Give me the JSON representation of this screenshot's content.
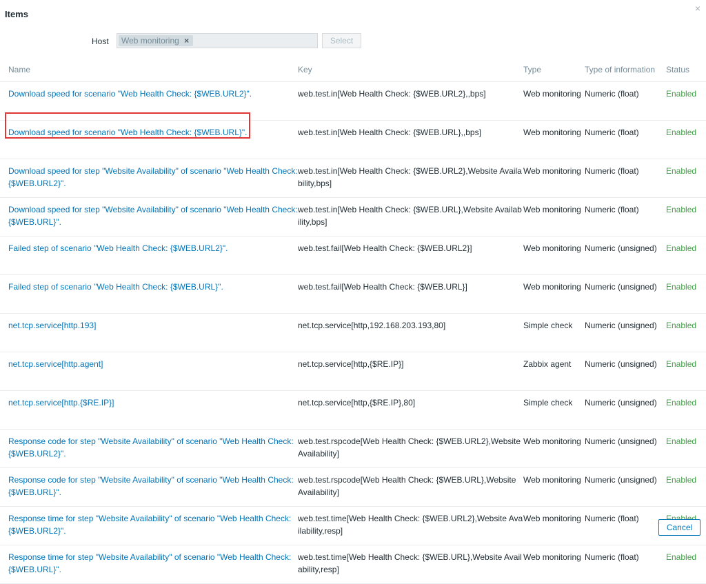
{
  "dialog": {
    "title": "Items",
    "close_icon": "×"
  },
  "filter": {
    "host_label": "Host",
    "selected_host": "Web monitoring",
    "chip_remove": "×",
    "select_button": "Select"
  },
  "table": {
    "columns": [
      "Name",
      "Key",
      "Type",
      "Type of information",
      "Status"
    ],
    "rows": [
      {
        "name": "Download speed for scenario \"Web Health Check: {$WEB.URL2}\".",
        "key": "web.test.in[Web Health Check: {$WEB.URL2},,bps]",
        "type": "Web monitoring",
        "info": "Numeric (float)",
        "status": "Enabled"
      },
      {
        "name": "Download speed for scenario \"Web Health Check: {$WEB.URL}\".",
        "key": "web.test.in[Web Health Check: {$WEB.URL},,bps]",
        "type": "Web monitoring",
        "info": "Numeric (float)",
        "status": "Enabled"
      },
      {
        "name": "Download speed for step \"Website Availability\" of scenario \"Web Health Check: {$WEB.URL2}\".",
        "key": "web.test.in[Web Health Check: {$WEB.URL2},Website Availability,bps]",
        "type": "Web monitoring",
        "info": "Numeric (float)",
        "status": "Enabled"
      },
      {
        "name": "Download speed for step \"Website Availability\" of scenario \"Web Health Check: {$WEB.URL}\".",
        "key": "web.test.in[Web Health Check: {$WEB.URL},Website Availability,bps]",
        "type": "Web monitoring",
        "info": "Numeric (float)",
        "status": "Enabled"
      },
      {
        "name": "Failed step of scenario \"Web Health Check: {$WEB.URL2}\".",
        "key": "web.test.fail[Web Health Check: {$WEB.URL2}]",
        "type": "Web monitoring",
        "info": "Numeric (unsigned)",
        "status": "Enabled"
      },
      {
        "name": "Failed step of scenario \"Web Health Check: {$WEB.URL}\".",
        "key": "web.test.fail[Web Health Check: {$WEB.URL}]",
        "type": "Web monitoring",
        "info": "Numeric (unsigned)",
        "status": "Enabled"
      },
      {
        "name": "net.tcp.service[http.193]",
        "key": "net.tcp.service[http,192.168.203.193,80]",
        "type": "Simple check",
        "info": "Numeric (unsigned)",
        "status": "Enabled"
      },
      {
        "name": "net.tcp.service[http.agent]",
        "key": "net.tcp.service[http,{$RE.IP}]",
        "type": "Zabbix agent",
        "info": "Numeric (unsigned)",
        "status": "Enabled"
      },
      {
        "name": "net.tcp.service[http.{$RE.IP}]",
        "key": "net.tcp.service[http,{$RE.IP},80]",
        "type": "Simple check",
        "info": "Numeric (unsigned)",
        "status": "Enabled"
      },
      {
        "name": "Response code for step \"Website Availability\" of scenario \"Web Health Check: {$WEB.URL2}\".",
        "key": "web.test.rspcode[Web Health Check: {$WEB.URL2},Website Availability]",
        "type": "Web monitoring",
        "info": "Numeric (unsigned)",
        "status": "Enabled"
      },
      {
        "name": "Response code for step \"Website Availability\" of scenario \"Web Health Check: {$WEB.URL}\".",
        "key": "web.test.rspcode[Web Health Check: {$WEB.URL},Website Availability]",
        "type": "Web monitoring",
        "info": "Numeric (unsigned)",
        "status": "Enabled"
      },
      {
        "name": "Response time for step \"Website Availability\" of scenario \"Web Health Check: {$WEB.URL2}\".",
        "key": "web.test.time[Web Health Check: {$WEB.URL2},Website Availability,resp]",
        "type": "Web monitoring",
        "info": "Numeric (float)",
        "status": "Enabled"
      },
      {
        "name": "Response time for step \"Website Availability\" of scenario \"Web Health Check: {$WEB.URL}\".",
        "key": "web.test.time[Web Health Check: {$WEB.URL},Website Availability,resp]",
        "type": "Web monitoring",
        "info": "Numeric (float)",
        "status": "Enabled"
      }
    ]
  },
  "footer": {
    "cancel_button": "Cancel"
  },
  "colors": {
    "link": "#0275b8",
    "status_enabled": "#429e47",
    "highlight": "#e03535"
  }
}
